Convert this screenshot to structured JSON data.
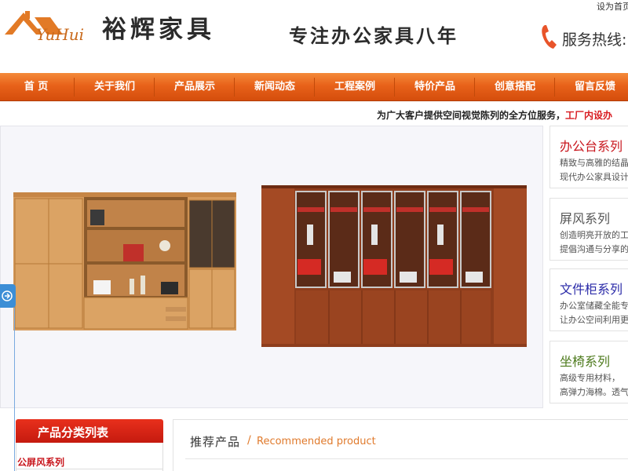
{
  "header": {
    "logo_text": "YuHui",
    "brand_cn": "裕辉家具",
    "slogan": "专注办公家具八年",
    "hotline": "服务热线:",
    "set_home": "设为首页"
  },
  "nav": {
    "items": [
      {
        "label": "首 页"
      },
      {
        "label": "关于我们"
      },
      {
        "label": "产品展示"
      },
      {
        "label": "新闻动态"
      },
      {
        "label": "工程案例"
      },
      {
        "label": "特价产品"
      },
      {
        "label": "创意搭配"
      },
      {
        "label": "留言反馈"
      }
    ]
  },
  "notice": {
    "text": "为广大客户提供空间视觉陈列的全方位服务，",
    "highlight": "工厂内设办"
  },
  "categories": [
    {
      "title": "办公台系列",
      "line1": "精致与高雅的结晶",
      "line2": "现代办公家具设计",
      "color": "#c8161d"
    },
    {
      "title": "屏风系列",
      "line1": "创造明亮开放的工",
      "line2": "提倡沟通与分享的",
      "color": "#555555"
    },
    {
      "title": "文件柜系列",
      "line1": "办公室储藏全能专",
      "line2": "让办公空间利用更",
      "color": "#2a2aa8"
    },
    {
      "title": "坐椅系列",
      "line1": "高级专用材料，",
      "line2": "高弹力海棉。透气",
      "color": "#4d7a1c"
    }
  ],
  "product_list": {
    "title": "产品分类列表",
    "items": [
      {
        "label": "公屏风系列"
      }
    ]
  },
  "recommended": {
    "title_cn": "推荐产品",
    "slash": "/",
    "title_en": "Recommended product"
  },
  "colors": {
    "nav_orange": "#e8621a",
    "accent_red": "#c8161d",
    "accent_orange": "#e07a2c"
  }
}
